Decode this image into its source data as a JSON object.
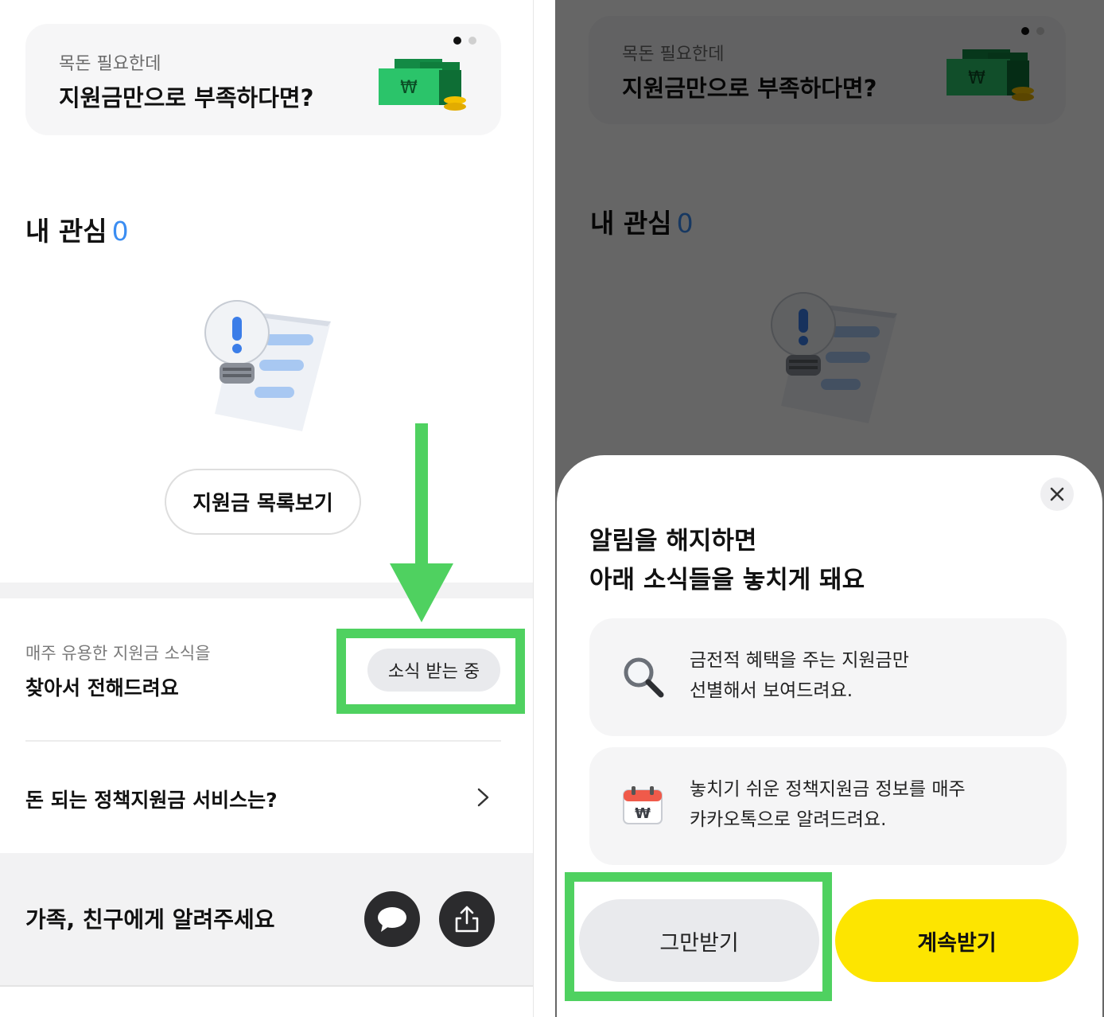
{
  "banner": {
    "subtitle": "목돈 필요한데",
    "title": "지원금만으로 부족하다면?",
    "money_icon": "won-money-icon"
  },
  "interest": {
    "label": "내 관심",
    "count": "0"
  },
  "list_button": {
    "label": "지원금 목록보기"
  },
  "news": {
    "subtitle": "매주 유용한 지원금 소식을",
    "title": "찾아서 전해드려요",
    "status_button": "소식 받는 중"
  },
  "service": {
    "label": "돈 되는 정책지원금 서비스는?"
  },
  "share": {
    "label": "가족, 친구에게 알려주세요",
    "icons": [
      "chat-bubble-icon",
      "share-icon"
    ]
  },
  "modal": {
    "title_line1": "알림을 해지하면",
    "title_line2": "아래 소식들을 놓치게 돼요",
    "benefits": [
      {
        "icon": "magnifier-icon",
        "line1": "금전적 혜택을 주는 지원금만",
        "line2": "선별해서 보여드려요."
      },
      {
        "icon": "calendar-won-icon",
        "line1": "놓치기 쉬운 정책지원금 정보를 매주",
        "line2": "카카오톡으로 알려드려요."
      }
    ],
    "stop_button": "그만받기",
    "continue_button": "계속받기"
  },
  "colors": {
    "accent_blue": "#3b8df2",
    "highlight_green": "#4fd160",
    "kakao_yellow": "#fde500"
  }
}
